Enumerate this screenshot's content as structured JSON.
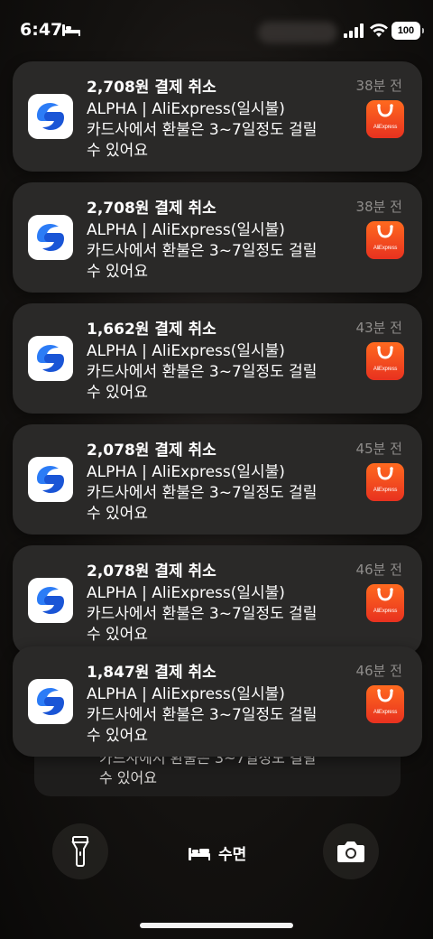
{
  "status_bar": {
    "time": "6:47",
    "battery": "100"
  },
  "notifications": [
    {
      "title": "2,708원 결제 취소",
      "time_ago": "38분 전",
      "line1": "ALPHA | AliExpress(일시불)",
      "line2": "카드사에서 환불은 3~7일정도 걸릴",
      "line3": "수 있어요"
    },
    {
      "title": "2,708원 결제 취소",
      "time_ago": "38분 전",
      "line1": "ALPHA | AliExpress(일시불)",
      "line2": "카드사에서 환불은 3~7일정도 걸릴",
      "line3": "수 있어요"
    },
    {
      "title": "1,662원 결제 취소",
      "time_ago": "43분 전",
      "line1": "ALPHA | AliExpress(일시불)",
      "line2": "카드사에서 환불은 3~7일정도 걸릴",
      "line3": "수 있어요"
    },
    {
      "title": "2,078원 결제 취소",
      "time_ago": "45분 전",
      "line1": "ALPHA | AliExpress(일시불)",
      "line2": "카드사에서 환불은 3~7일정도 걸릴",
      "line3": "수 있어요"
    },
    {
      "title": "2,078원 결제 취소",
      "time_ago": "46분 전",
      "line1": "ALPHA | AliExpress(일시불)",
      "line2": "카드사에서 환불은 3~7일정도 걸릴",
      "line3": "수 있어요"
    },
    {
      "title": "1,847원 결제 취소",
      "time_ago": "46분 전",
      "line1": "ALPHA | AliExpress(일시불)",
      "line2": "카드사에서 환불은 3~7일정도 걸릴",
      "line3": "수 있어요"
    }
  ],
  "stacked_peek": {
    "line1": "카드사에서 환불은 3~7일정도 걸릴",
    "line2": "수 있어요"
  },
  "ali_badge_text": "AliExpress",
  "bottom": {
    "sleep_label": "수면"
  },
  "colors": {
    "card_bg": "#2a2928",
    "ali_orange": "#ff6a1f",
    "ali_red": "#e8311f",
    "app_blue": "#1f6cf5"
  }
}
